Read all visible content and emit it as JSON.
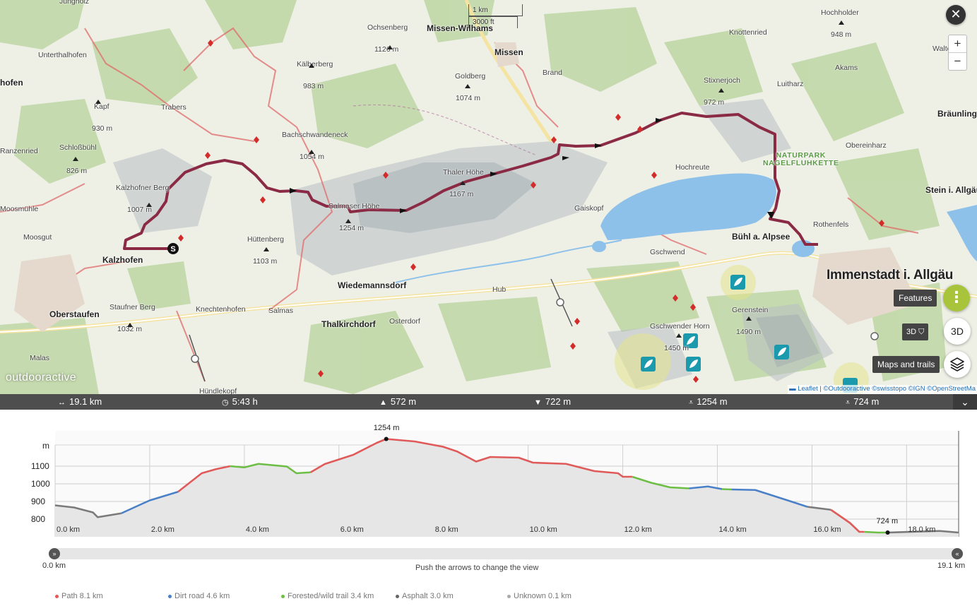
{
  "map": {
    "scale": {
      "km": "1 km",
      "ft": "3000 ft"
    },
    "places": [
      {
        "name": "Jungholz",
        "cls": "small"
      },
      {
        "name": "Unterthalhofen",
        "cls": "small"
      },
      {
        "name": "hofen",
        "cls": "town"
      },
      {
        "name": "Kapf",
        "cls": "small"
      },
      {
        "name": "930 m",
        "cls": "small"
      },
      {
        "name": "Schloßbühl",
        "cls": "small"
      },
      {
        "name": "826 m",
        "cls": "small"
      },
      {
        "name": "Ranzenried",
        "cls": "small"
      },
      {
        "name": "Moosmühle",
        "cls": "small"
      },
      {
        "name": "Kalzhofner Berg",
        "cls": "small"
      },
      {
        "name": "1007 m",
        "cls": "small"
      },
      {
        "name": "Kalzhofen",
        "cls": "town"
      },
      {
        "name": "Moosgut",
        "cls": "small"
      },
      {
        "name": "Oberstaufen",
        "cls": "town"
      },
      {
        "name": "Staufner Berg",
        "cls": "small"
      },
      {
        "name": "1032 m",
        "cls": "small"
      },
      {
        "name": "Malas",
        "cls": "small"
      },
      {
        "name": "Knechtenhofen",
        "cls": "small"
      },
      {
        "name": "Salmas",
        "cls": "small"
      },
      {
        "name": "Hündlekopf",
        "cls": "small"
      },
      {
        "name": "Trabers",
        "cls": "small"
      },
      {
        "name": "Kälberberg",
        "cls": "small"
      },
      {
        "name": "983 m",
        "cls": "small"
      },
      {
        "name": "Ochsenberg",
        "cls": "small"
      },
      {
        "name": "1126 m",
        "cls": "small"
      },
      {
        "name": "Bachschwandeneck",
        "cls": "small"
      },
      {
        "name": "1054 m",
        "cls": "small"
      },
      {
        "name": "Hüttenberg",
        "cls": "small"
      },
      {
        "name": "1103 m",
        "cls": "small"
      },
      {
        "name": "Salmaser Höhe",
        "cls": "small"
      },
      {
        "name": "1254 m",
        "cls": "small"
      },
      {
        "name": "Wiedemannsdorf",
        "cls": "town"
      },
      {
        "name": "Thalkirchdorf",
        "cls": "town"
      },
      {
        "name": "Osterdorf",
        "cls": "small"
      },
      {
        "name": "Thaler Höhe",
        "cls": "small"
      },
      {
        "name": "1167 m",
        "cls": "small"
      },
      {
        "name": "Missen-Wilhams",
        "cls": "town"
      },
      {
        "name": "Missen",
        "cls": "town"
      },
      {
        "name": "Goldberg",
        "cls": "small"
      },
      {
        "name": "1074 m",
        "cls": "small"
      },
      {
        "name": "Brand",
        "cls": "small"
      },
      {
        "name": "Hub",
        "cls": "small"
      },
      {
        "name": "Gaiskopf",
        "cls": "small"
      },
      {
        "name": "Hochreute",
        "cls": "small"
      },
      {
        "name": "Gschwend",
        "cls": "small"
      },
      {
        "name": "Stixnerjoch",
        "cls": "small"
      },
      {
        "name": "972 m",
        "cls": "small"
      },
      {
        "name": "Knottenried",
        "cls": "small"
      },
      {
        "name": "Luitharz",
        "cls": "small"
      },
      {
        "name": "Hochholder",
        "cls": "small"
      },
      {
        "name": "948 m",
        "cls": "small"
      },
      {
        "name": "Akams",
        "cls": "small"
      },
      {
        "name": "Walterst",
        "cls": "small"
      },
      {
        "name": "Bräunlings",
        "cls": "town"
      },
      {
        "name": "Obereinharz",
        "cls": "small"
      },
      {
        "name": "Stein i. Allgäu",
        "cls": "town"
      },
      {
        "name": "Rothenfels",
        "cls": "small"
      },
      {
        "name": "Bühl a. Alpsee",
        "cls": "town"
      },
      {
        "name": "Immenstadt i. Allgäu",
        "cls": "city"
      },
      {
        "name": "Gerenstein",
        "cls": "small"
      },
      {
        "name": "1490 m",
        "cls": "small"
      },
      {
        "name": "Gschwender Horn",
        "cls": "small"
      },
      {
        "name": "1450 m",
        "cls": "small"
      }
    ],
    "park_label": [
      "NATURPARK",
      "NAGELFLUHKETTE"
    ],
    "start_marker": "S",
    "logo": "outdooractive",
    "attribution": {
      "leaflet": "Leaflet",
      "sep": " | ",
      "oa": "©Outdooractive",
      "swisstopo": "©swisstopo",
      "ign": "©IGN",
      "osm": "©OpenStreetMa"
    },
    "controls": {
      "close": "✕",
      "zoom_in": "+",
      "zoom_out": "−",
      "features_label": "Features",
      "features_icon": "⋮",
      "btn_3d": "3D",
      "tip_3d": "3D",
      "maps_label": "Maps and trails",
      "layers_icon": "layers-icon"
    },
    "colors": {
      "route": "#8b2a45",
      "water": "#8ec1ea",
      "forest": "#b7d49d"
    }
  },
  "stats": {
    "distance": "19.1 km",
    "duration": "5:43 h",
    "ascent": "572 m",
    "descent": "722 m",
    "highest": "1254 m",
    "lowest": "724 m"
  },
  "chart_data": {
    "type": "area",
    "title": "",
    "xlabel": "",
    "ylabel": "m",
    "xlim": [
      0,
      19.1
    ],
    "ylim": [
      700,
      1300
    ],
    "y_ticks": [
      "1100",
      "1000",
      "900",
      "800"
    ],
    "x_ticks": [
      "0.0 km",
      "2.0 km",
      "4.0 km",
      "6.0 km",
      "8.0 km",
      "10.0 km",
      "12.0 km",
      "14.0 km",
      "16.0 km",
      "18.0 km"
    ],
    "annotations": {
      "max": "1254 m",
      "min": "724 m"
    },
    "profile": [
      {
        "x": 0.0,
        "y": 878,
        "s": "asphalt"
      },
      {
        "x": 0.4,
        "y": 866,
        "s": "asphalt"
      },
      {
        "x": 0.8,
        "y": 838,
        "s": "asphalt"
      },
      {
        "x": 0.9,
        "y": 811,
        "s": "asphalt"
      },
      {
        "x": 1.4,
        "y": 833,
        "s": "asphalt"
      },
      {
        "x": 1.4,
        "y": 833,
        "s": "dirt"
      },
      {
        "x": 1.8,
        "y": 882,
        "s": "dirt"
      },
      {
        "x": 2.0,
        "y": 906,
        "s": "dirt"
      },
      {
        "x": 2.6,
        "y": 955,
        "s": "dirt"
      },
      {
        "x": 2.6,
        "y": 955,
        "s": "path"
      },
      {
        "x": 3.1,
        "y": 1060,
        "s": "path"
      },
      {
        "x": 3.4,
        "y": 1083,
        "s": "path"
      },
      {
        "x": 3.7,
        "y": 1100,
        "s": "path"
      },
      {
        "x": 3.7,
        "y": 1100,
        "s": "forest"
      },
      {
        "x": 4.0,
        "y": 1093,
        "s": "forest"
      },
      {
        "x": 4.3,
        "y": 1113,
        "s": "forest"
      },
      {
        "x": 4.9,
        "y": 1098,
        "s": "forest"
      },
      {
        "x": 5.1,
        "y": 1060,
        "s": "forest"
      },
      {
        "x": 5.4,
        "y": 1065,
        "s": "forest"
      },
      {
        "x": 5.4,
        "y": 1065,
        "s": "path"
      },
      {
        "x": 5.7,
        "y": 1112,
        "s": "path"
      },
      {
        "x": 6.3,
        "y": 1164,
        "s": "path"
      },
      {
        "x": 6.8,
        "y": 1232,
        "s": "path"
      },
      {
        "x": 7.0,
        "y": 1254,
        "s": "path"
      },
      {
        "x": 7.6,
        "y": 1240,
        "s": "path"
      },
      {
        "x": 8.2,
        "y": 1210,
        "s": "path"
      },
      {
        "x": 8.5,
        "y": 1183,
        "s": "path"
      },
      {
        "x": 8.9,
        "y": 1126,
        "s": "path"
      },
      {
        "x": 9.2,
        "y": 1152,
        "s": "path"
      },
      {
        "x": 9.8,
        "y": 1148,
        "s": "path"
      },
      {
        "x": 10.1,
        "y": 1120,
        "s": "path"
      },
      {
        "x": 10.8,
        "y": 1113,
        "s": "path"
      },
      {
        "x": 11.4,
        "y": 1072,
        "s": "path"
      },
      {
        "x": 11.9,
        "y": 1060,
        "s": "path"
      },
      {
        "x": 12.0,
        "y": 1040,
        "s": "path"
      },
      {
        "x": 12.2,
        "y": 1040,
        "s": "path"
      },
      {
        "x": 12.2,
        "y": 1040,
        "s": "forest"
      },
      {
        "x": 12.6,
        "y": 1006,
        "s": "forest"
      },
      {
        "x": 13.0,
        "y": 980,
        "s": "forest"
      },
      {
        "x": 13.4,
        "y": 974,
        "s": "forest"
      },
      {
        "x": 13.4,
        "y": 974,
        "s": "dirt"
      },
      {
        "x": 13.8,
        "y": 985,
        "s": "dirt"
      },
      {
        "x": 14.1,
        "y": 970,
        "s": "dirt"
      },
      {
        "x": 14.1,
        "y": 970,
        "s": "forest"
      },
      {
        "x": 14.3,
        "y": 968,
        "s": "forest"
      },
      {
        "x": 14.3,
        "y": 968,
        "s": "dirt"
      },
      {
        "x": 14.8,
        "y": 965,
        "s": "dirt"
      },
      {
        "x": 15.5,
        "y": 905,
        "s": "dirt"
      },
      {
        "x": 15.9,
        "y": 870,
        "s": "dirt"
      },
      {
        "x": 15.9,
        "y": 870,
        "s": "asphalt"
      },
      {
        "x": 16.4,
        "y": 853,
        "s": "asphalt"
      },
      {
        "x": 16.4,
        "y": 853,
        "s": "path"
      },
      {
        "x": 16.8,
        "y": 779,
        "s": "path"
      },
      {
        "x": 17.0,
        "y": 728,
        "s": "path"
      },
      {
        "x": 17.1,
        "y": 728,
        "s": "path"
      },
      {
        "x": 17.1,
        "y": 728,
        "s": "forest"
      },
      {
        "x": 17.4,
        "y": 724,
        "s": "forest"
      },
      {
        "x": 17.6,
        "y": 724,
        "s": "forest"
      },
      {
        "x": 17.6,
        "y": 724,
        "s": "asphalt"
      },
      {
        "x": 18.7,
        "y": 733,
        "s": "asphalt"
      },
      {
        "x": 19.1,
        "y": 724,
        "s": "asphalt"
      }
    ],
    "max_point": {
      "x": 7.0,
      "y": 1254
    },
    "min_point": {
      "x": 17.6,
      "y": 724
    },
    "surface_colors": {
      "path": "#e05a5a",
      "dirt": "#4a80c8",
      "forest": "#6cbe45",
      "asphalt": "#7a7a7a",
      "unknown": "#aaaaaa"
    }
  },
  "slider": {
    "left_label": "0.0 km",
    "right_label": "19.1 km",
    "hint": "Push the arrows to change the view",
    "left_icon": "»",
    "right_icon": "«"
  },
  "legend": [
    {
      "label": "Path 8.1 km",
      "color": "#e05a5a"
    },
    {
      "label": "Dirt road 4.6 km",
      "color": "#4a80c8"
    },
    {
      "label": "Forested/wild trail 3.4 km",
      "color": "#6cbe45"
    },
    {
      "label": "Asphalt 3.0 km",
      "color": "#666666"
    },
    {
      "label": "Unknown 0.1 km",
      "color": "#aaaaaa"
    }
  ]
}
